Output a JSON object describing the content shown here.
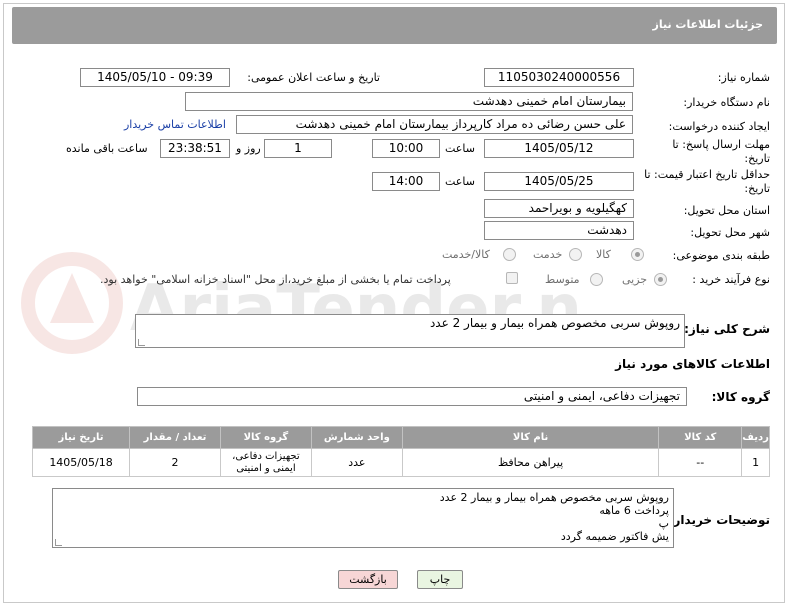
{
  "header": {
    "title": "جزئیات اطلاعات نیاز"
  },
  "labels": {
    "need_number": "شماره نیاز:",
    "announce_datetime": "تاریخ و ساعت اعلان عمومی:",
    "buyer_org": "نام دستگاه خریدار:",
    "requester": "ایجاد کننده درخواست:",
    "reply_deadline": "مهلت ارسال پاسخ: تا تاریخ:",
    "hour": "ساعت",
    "day_and": "روز و",
    "hours_remaining": "ساعت باقی مانده",
    "price_validity": "حداقل تاریخ اعتبار قیمت: تا تاریخ:",
    "delivery_province": "استان محل تحویل:",
    "delivery_city": "شهر محل تحویل:",
    "category": "طبقه بندی موضوعی:",
    "purchase_type": "نوع فرآیند خرید :",
    "need_description": "شرح کلی نیاز:",
    "goods_info": "اطلاعات کالاهای مورد نیاز",
    "goods_group": "گروه کالا:",
    "buyer_notes": "توضیحات خریدار:"
  },
  "values": {
    "need_number": "1105030240000556",
    "announce_datetime": "1405/05/10 - 09:39",
    "buyer_org": "بیمارستان امام خمینی دهدشت",
    "requester": "علی حسن رضائی ده مراد کارپرداز بیمارستان امام خمینی دهدشت",
    "contact_link": "اطلاعات تماس خریدار",
    "reply_date": "1405/05/12",
    "reply_time": "10:00",
    "reply_days": "1",
    "reply_remaining": "23:38:51",
    "price_date": "1405/05/25",
    "price_time": "14:00",
    "delivery_province": "کهگیلویه و بویراحمد",
    "delivery_city": "دهدشت",
    "need_description": "روپوش سربی مخصوص همراه بیمار و بیمار 2 عدد",
    "goods_group": "تجهیزات دفاعی، ایمنی و امنیتی",
    "buyer_notes_lines": [
      "روپوش سربی مخصوص همراه بیمار و بیمار 2 عدد",
      "پرداخت 6 ماهه",
      "پ",
      "یش فاکتور ضمیمه گردد"
    ]
  },
  "category_options": [
    {
      "label": "کالا",
      "selected": true
    },
    {
      "label": "خدمت",
      "selected": false
    },
    {
      "label": "کالا/خدمت",
      "selected": false
    }
  ],
  "purchase_options": [
    {
      "label": "جزیی",
      "selected": true
    },
    {
      "label": "متوسط",
      "selected": false
    }
  ],
  "payment_note": "پرداخت تمام یا بخشی از مبلغ خرید،از محل \"اسناد خزانه اسلامی\" خواهد بود.",
  "table": {
    "headers": [
      "ردیف",
      "کد کالا",
      "نام کالا",
      "واحد شمارش",
      "گروه کالا",
      "تعداد / مقدار",
      "تاریخ نیاز"
    ],
    "rows": [
      [
        "1",
        "--",
        "پیراهن محافظ",
        "عدد",
        "تجهیزات دفاعی، ایمنی و امنیتی",
        "2",
        "1405/05/18"
      ]
    ]
  },
  "buttons": {
    "print": "چاپ",
    "back": "بازگشت"
  },
  "watermark": "AriaTender.net",
  "colors": {
    "header_bg": "#9b9b9b",
    "link": "#1a3fa6",
    "back_btn": "#f7d6d6",
    "print_btn": "#e9f5e1"
  }
}
